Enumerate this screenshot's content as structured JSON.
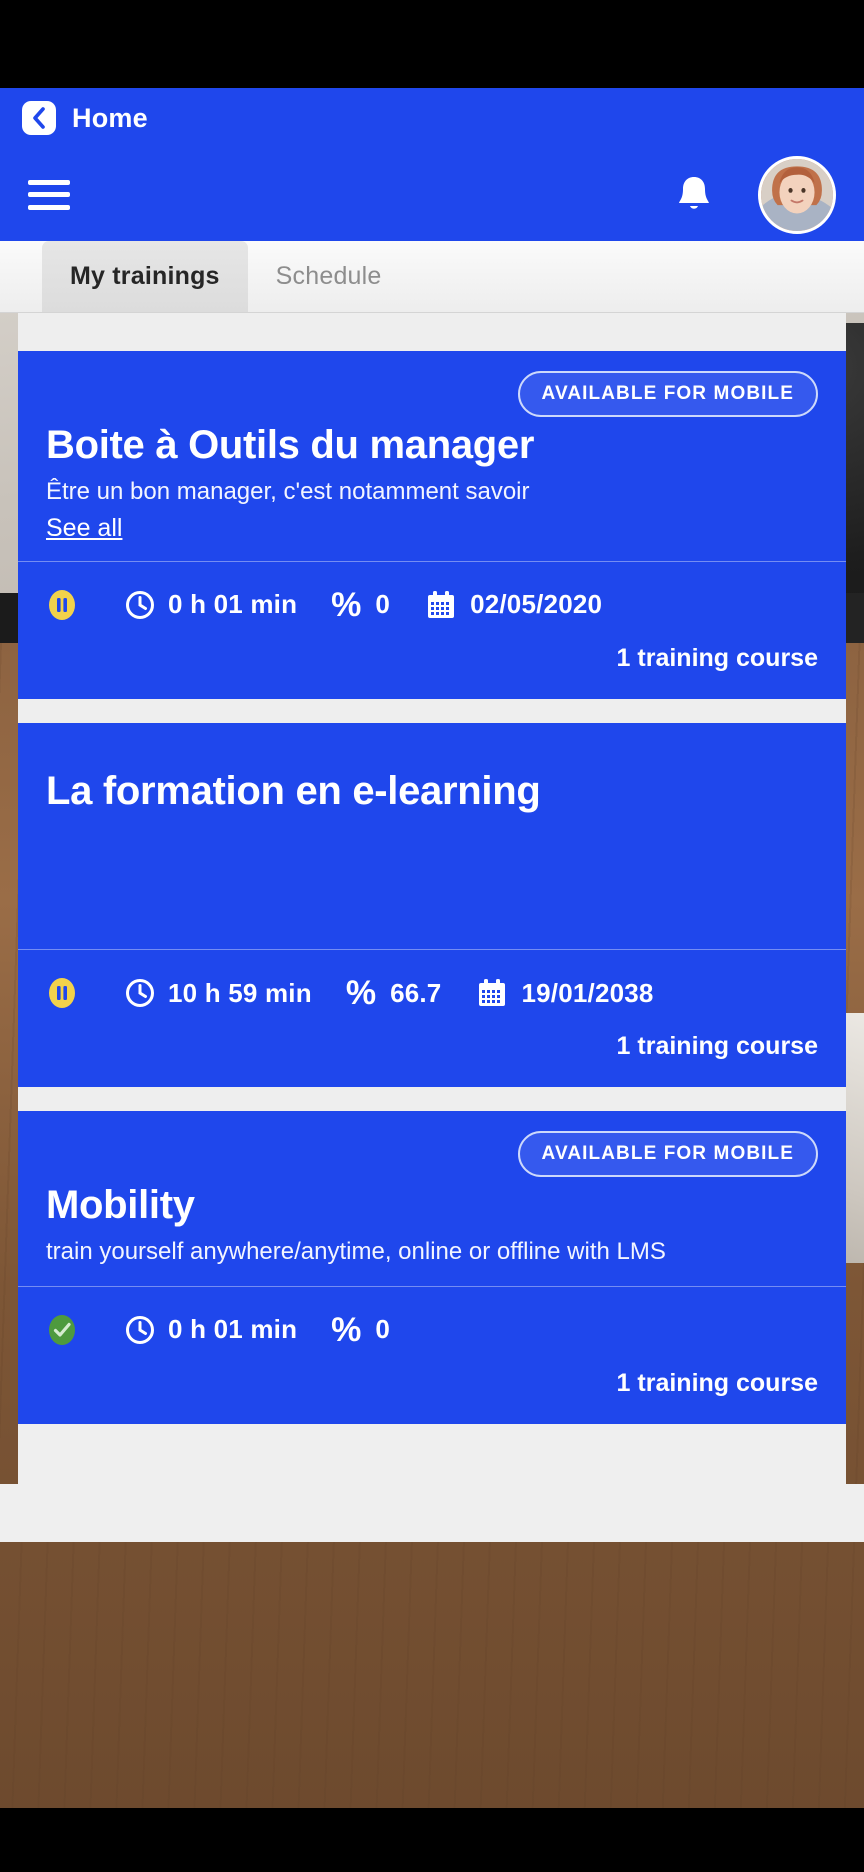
{
  "header": {
    "back_label": "Home",
    "back_icon": "chevron-left-icon",
    "menu_icon": "hamburger-menu-icon",
    "notification_icon": "bell-icon",
    "avatar_icon": "user-avatar",
    "background_color": "#1f47ec"
  },
  "tabs": [
    {
      "label": "My trainings",
      "active": true
    },
    {
      "label": "Schedule",
      "active": false
    }
  ],
  "cards": [
    {
      "badge": "AVAILABLE FOR MOBILE",
      "has_badge": true,
      "title": "Boite à Outils du manager",
      "description": "Être un bon manager, c'est notamment savoir",
      "see_all": "See all",
      "status_icon": "pause-icon",
      "status_color": "#f2d24b",
      "duration_icon": "clock-icon",
      "duration": "0 h 01 min",
      "percent_symbol": "%",
      "percent": "0",
      "date_icon": "calendar-icon",
      "date": "02/05/2020",
      "has_date": true,
      "course_count": "1 training course"
    },
    {
      "badge": "",
      "has_badge": false,
      "title": "La formation en e-learning",
      "description": "",
      "see_all": "",
      "status_icon": "pause-icon",
      "status_color": "#f2d24b",
      "duration_icon": "clock-icon",
      "duration": "10 h 59 min",
      "percent_symbol": "%",
      "percent": "66.7",
      "date_icon": "calendar-icon",
      "date": "19/01/2038",
      "has_date": true,
      "course_count": "1 training course"
    },
    {
      "badge": "AVAILABLE FOR MOBILE",
      "has_badge": true,
      "title": "Mobility",
      "description": "train yourself anywhere/anytime, online or offline with LMS",
      "see_all": "",
      "status_icon": "check-circle-icon",
      "status_color": "#4e9a3e",
      "duration_icon": "clock-icon",
      "duration": "0 h 01 min",
      "percent_symbol": "%",
      "percent": "0",
      "date_icon": "calendar-icon",
      "date": "",
      "has_date": false,
      "course_count": "1 training course"
    }
  ],
  "theme": {
    "card_blue": "#1f47ec",
    "page_gray": "#efefef",
    "tab_active_text": "#262626",
    "tab_inactive_text": "#8d8d8d"
  }
}
